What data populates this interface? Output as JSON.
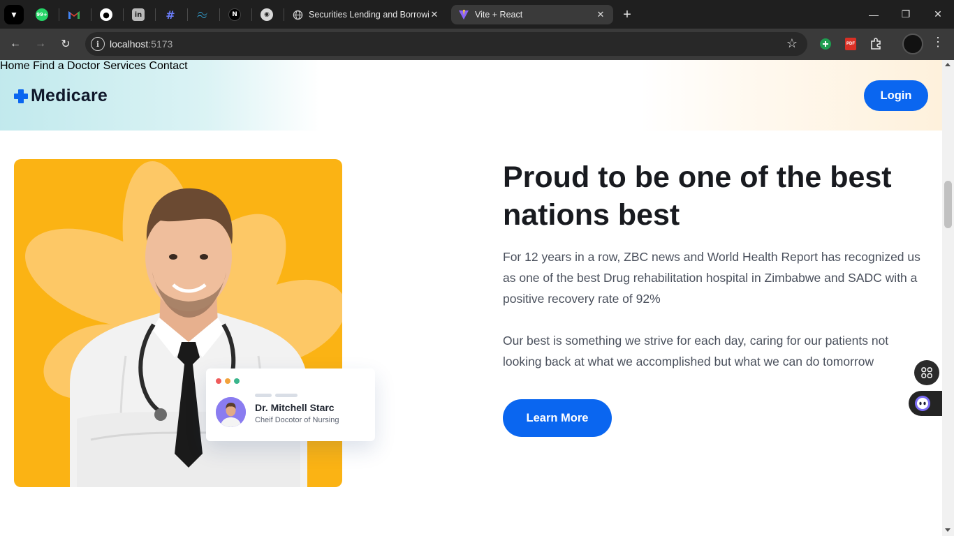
{
  "browser": {
    "tabs": [
      {
        "title": "Securities Lending and Borrowin",
        "active": false
      },
      {
        "title": "Vite + React",
        "active": true
      }
    ],
    "pinned_icons": [
      "whatsapp-icon",
      "gmail-icon",
      "github-icon",
      "linkedin-icon",
      "hashnode-icon",
      "tailwind-icon",
      "nextjs-icon",
      "copilot-icon"
    ],
    "whatsapp_badge": "99+",
    "url_host": "localhost",
    "url_port": ":5173",
    "new_tab_symbol": "+",
    "tab_close_symbol": "✕"
  },
  "site": {
    "brand": "Medicare",
    "nav": [
      "Home",
      "Find a Doctor",
      "Services",
      "Contact"
    ],
    "login_label": "Login",
    "accent": "#0a66f0"
  },
  "hero": {
    "title": "Proud to be one of the best nations best",
    "paragraph1": "For 12 years in a row, ZBC news and World Health Report has recognized us as one of the best Drug rehabilitation hospital in Zimbabwe and SADC with a positive recovery rate of 92%",
    "paragraph2": "Our best is something we strive for each day, caring for our patients not looking back at what we accomplished but what we can do tomorrow",
    "cta_label": "Learn More",
    "image_bg": "#fbb314"
  },
  "doctor_card": {
    "name": "Dr. Mitchell Starc",
    "role": "Cheif Docotor of Nursing"
  }
}
